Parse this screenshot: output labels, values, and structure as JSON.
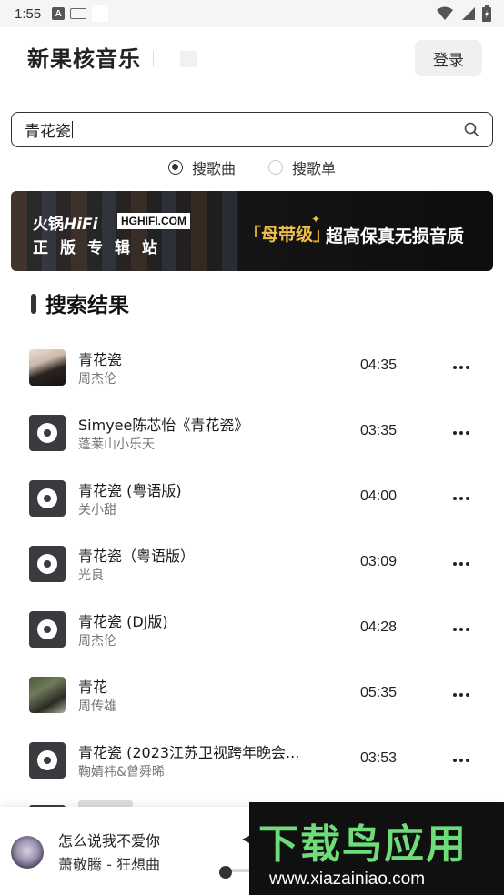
{
  "status_bar": {
    "time": "1:55",
    "notif_a": "A"
  },
  "header": {
    "app_title": "新果核音乐",
    "login_label": "登录"
  },
  "search": {
    "query": "青花瓷"
  },
  "search_type": {
    "options": [
      "搜歌曲",
      "搜歌单"
    ],
    "selected": "搜歌曲"
  },
  "banner": {
    "brand_prefix": "火锅",
    "brand_suffix": "HiFi",
    "url_badge": "HGHIFI.COM",
    "subtitle": "正版专辑站",
    "tag_open": "「",
    "tag": "母带级",
    "tag_close": "」",
    "tagline": "超高保真无损音质"
  },
  "results": {
    "section_title": "搜索结果",
    "songs": [
      {
        "title": "青花瓷",
        "artist": "周杰伦",
        "duration": "04:35",
        "cover": "photo-a"
      },
      {
        "title": "Simyee陈芯怡《青花瓷》",
        "artist": "蓬莱山小乐天",
        "duration": "03:35",
        "cover": "disc"
      },
      {
        "title": "青花瓷 (粤语版)",
        "artist": "关小甜",
        "duration": "04:00",
        "cover": "disc"
      },
      {
        "title": "青花瓷（粤语版）",
        "artist": "光良",
        "duration": "03:09",
        "cover": "disc"
      },
      {
        "title": "青花瓷 (DJ版)",
        "artist": "周杰伦",
        "duration": "04:28",
        "cover": "disc"
      },
      {
        "title": "青花",
        "artist": "周传雄",
        "duration": "05:35",
        "cover": "photo-b"
      },
      {
        "title": "青花瓷 (2023江苏卫视跨年晚会...",
        "artist": "鞠婧祎&曾舜晞",
        "duration": "03:53",
        "cover": "disc"
      }
    ]
  },
  "player": {
    "title": "怎么说我不爱你",
    "artist_album": "萧敬腾 - 狂想曲",
    "progress_percent": 5
  },
  "watermark": {
    "main": "下载鸟应用",
    "url": "www.xiazainiao.com"
  },
  "colors": {
    "accent": "#333333",
    "banner_gold": "#f0c048",
    "watermark_green": "#6fdc7a"
  }
}
